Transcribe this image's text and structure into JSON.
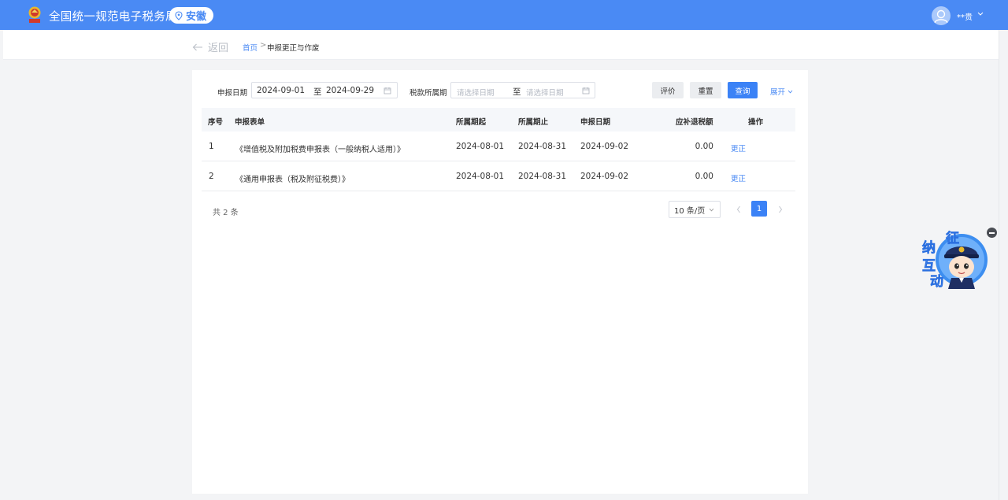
{
  "header": {
    "title": "全国统一规范电子税务局",
    "region": "安徽",
    "user_name": "**贵"
  },
  "breadcrumb": {
    "back_label": "返回",
    "home": "首页",
    "separator": ">",
    "current": "申报更正与作废"
  },
  "filter": {
    "declare_date_label": "申报日期",
    "declare_date_start": "2024-09-01",
    "declare_date_end": "2024-09-29",
    "range_sep": "至",
    "period_label": "税款所属期",
    "period_start_placeholder": "请选择日期",
    "period_end_placeholder": "请选择日期",
    "evaluate_label": "评价",
    "reset_label": "重置",
    "search_label": "查询",
    "expand_label": "展开"
  },
  "table": {
    "columns": [
      "序号",
      "申报表单",
      "所属期起",
      "所属期止",
      "申报日期",
      "应补退税额",
      "操作"
    ],
    "rows": [
      {
        "index": "1",
        "form": "《增值税及附加税费申报表（一般纳税人适用）》",
        "period_start": "2024-08-01",
        "period_end": "2024-08-31",
        "declare_date": "2024-09-02",
        "amount": "0.00",
        "action": "更正"
      },
      {
        "index": "2",
        "form": "《通用申报表（税及附征税费）》",
        "period_start": "2024-08-01",
        "period_end": "2024-08-31",
        "declare_date": "2024-09-02",
        "amount": "0.00",
        "action": "更正"
      }
    ]
  },
  "pagination": {
    "total_text": "共 2 条",
    "page_size": "10 条/页",
    "current_page": "1"
  },
  "widget": {
    "chars": [
      "征",
      "纳",
      "互",
      "动"
    ]
  },
  "colors": {
    "brand_blue": "#4a8af4",
    "primary_button": "#3b82f6"
  }
}
